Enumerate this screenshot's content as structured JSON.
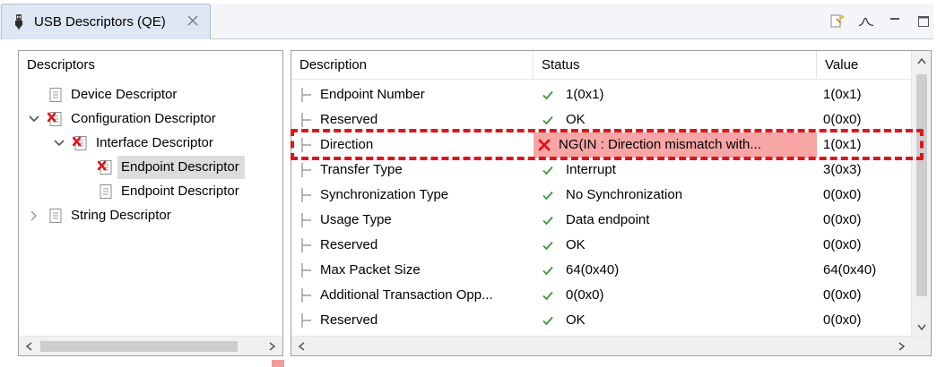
{
  "tab": {
    "title": "USB Descriptors (QE)",
    "icon": "usb-plug-icon",
    "close_icon": "close-icon"
  },
  "view_tools": [
    "wizard-icon",
    "waveform-icon",
    "minimize-icon",
    "maximize-icon"
  ],
  "tree": {
    "header": "Descriptors",
    "nodes": [
      {
        "label": "Device Descriptor",
        "icon": "document-icon",
        "level": 0,
        "expand": "none",
        "error": false,
        "selected": false
      },
      {
        "label": "Configuration Descriptor",
        "icon": "document-error-icon",
        "level": 0,
        "expand": "expanded",
        "error": true,
        "selected": false
      },
      {
        "label": "Interface Descriptor",
        "icon": "document-error-icon",
        "level": 1,
        "expand": "expanded",
        "error": true,
        "selected": false
      },
      {
        "label": "Endpoint Descriptor",
        "icon": "document-error-icon",
        "level": 2,
        "expand": "none",
        "error": true,
        "selected": true
      },
      {
        "label": "Endpoint Descriptor",
        "icon": "document-icon",
        "level": 2,
        "expand": "none",
        "error": false,
        "selected": false
      },
      {
        "label": "String Descriptor",
        "icon": "document-icon",
        "level": 0,
        "expand": "collapsed",
        "error": false,
        "selected": false
      }
    ]
  },
  "table": {
    "columns": {
      "description": "Description",
      "status": "Status",
      "value": "Value"
    },
    "rows": [
      {
        "description": "Endpoint Number",
        "status": "1(0x1)",
        "value": "1(0x1)",
        "state": "ok"
      },
      {
        "description": "Reserved",
        "status": "OK",
        "value": "0(0x0)",
        "state": "ok"
      },
      {
        "description": "Direction",
        "status": "NG(IN : Direction mismatch with...",
        "value": "1(0x1)",
        "state": "error"
      },
      {
        "description": "Transfer Type",
        "status": "Interrupt",
        "value": "3(0x3)",
        "state": "ok"
      },
      {
        "description": "Synchronization Type",
        "status": "No Synchronization",
        "value": "0(0x0)",
        "state": "ok"
      },
      {
        "description": "Usage Type",
        "status": "Data endpoint",
        "value": "0(0x0)",
        "state": "ok"
      },
      {
        "description": "Reserved",
        "status": "OK",
        "value": "0(0x0)",
        "state": "ok"
      },
      {
        "description": "Max Packet Size",
        "status": "64(0x40)",
        "value": "64(0x40)",
        "state": "ok"
      },
      {
        "description": "Additional Transaction Opp...",
        "status": "0(0x0)",
        "value": "0(0x0)",
        "state": "ok"
      },
      {
        "description": "Reserved",
        "status": "OK",
        "value": "0(0x0)",
        "state": "ok"
      }
    ]
  },
  "colors": {
    "ok_check": "#3a9a3a",
    "error_x": "#e0141c",
    "error_cell": "#f8a5a5",
    "selection": "#dcdcdc",
    "callout": "#e0141c"
  }
}
